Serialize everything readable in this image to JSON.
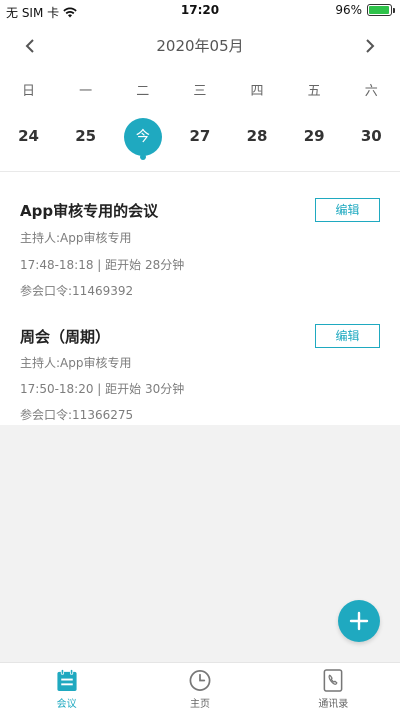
{
  "status_bar": {
    "carrier": "无 SIM 卡",
    "time": "17:20",
    "battery_percent": "96%",
    "battery_level": 0.96
  },
  "calendar": {
    "month_title": "2020年05月",
    "weekdays": [
      "日",
      "一",
      "二",
      "三",
      "四",
      "五",
      "六"
    ],
    "dates": [
      "24",
      "25",
      "今",
      "27",
      "28",
      "29",
      "30"
    ],
    "today_index": 2
  },
  "meetings": [
    {
      "title": "App审核专用的会议",
      "host": "主持人:App审核专用",
      "time": "17:48-18:18 | 距开始 28分钟",
      "password": "参会口令:11469392",
      "edit_label": "编辑"
    },
    {
      "title": "周会（周期）",
      "host": "主持人:App审核专用",
      "time": "17:50-18:20 | 距开始 30分钟",
      "password": "参会口令:11366275",
      "edit_label": "编辑"
    }
  ],
  "tabbar": {
    "items": [
      {
        "label": "会议",
        "icon": "meeting-icon",
        "active": true
      },
      {
        "label": "主页",
        "icon": "clock-icon",
        "active": false
      },
      {
        "label": "通讯录",
        "icon": "contacts-icon",
        "active": false
      }
    ]
  },
  "colors": {
    "accent": "#1fa9c0",
    "background_gray": "#f2f2f2"
  }
}
